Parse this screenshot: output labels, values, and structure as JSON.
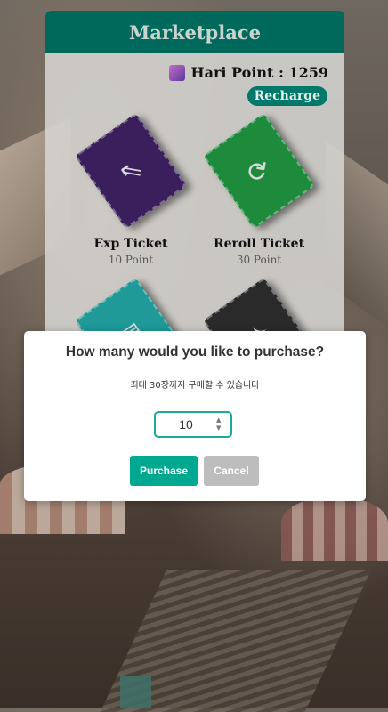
{
  "header": {
    "title": "Marketplace"
  },
  "points": {
    "label": "Hari Point : 1259",
    "recharge_label": "Recharge"
  },
  "tickets": [
    {
      "name": "Exp Ticket",
      "price": "10 Point",
      "color": "#3a1f5c",
      "icon": "arrows-up-left-icon"
    },
    {
      "name": "Reroll Ticket",
      "price": "30 Point",
      "color": "#1e8a3c",
      "icon": "refresh-icon"
    },
    {
      "color": "#1f9a99",
      "icon": "document-icon"
    },
    {
      "color": "#2a2a2a",
      "icon": "sparkle-icon"
    }
  ],
  "modal": {
    "title": "How many would you like to purchase?",
    "subtitle": "최대 30장까지 구매할 수 있습니다",
    "quantity": "10",
    "purchase_label": "Purchase",
    "cancel_label": "Cancel"
  },
  "colors": {
    "header": "#00695c",
    "purchase": "#00a88f",
    "cancel": "#bdbdbd"
  }
}
